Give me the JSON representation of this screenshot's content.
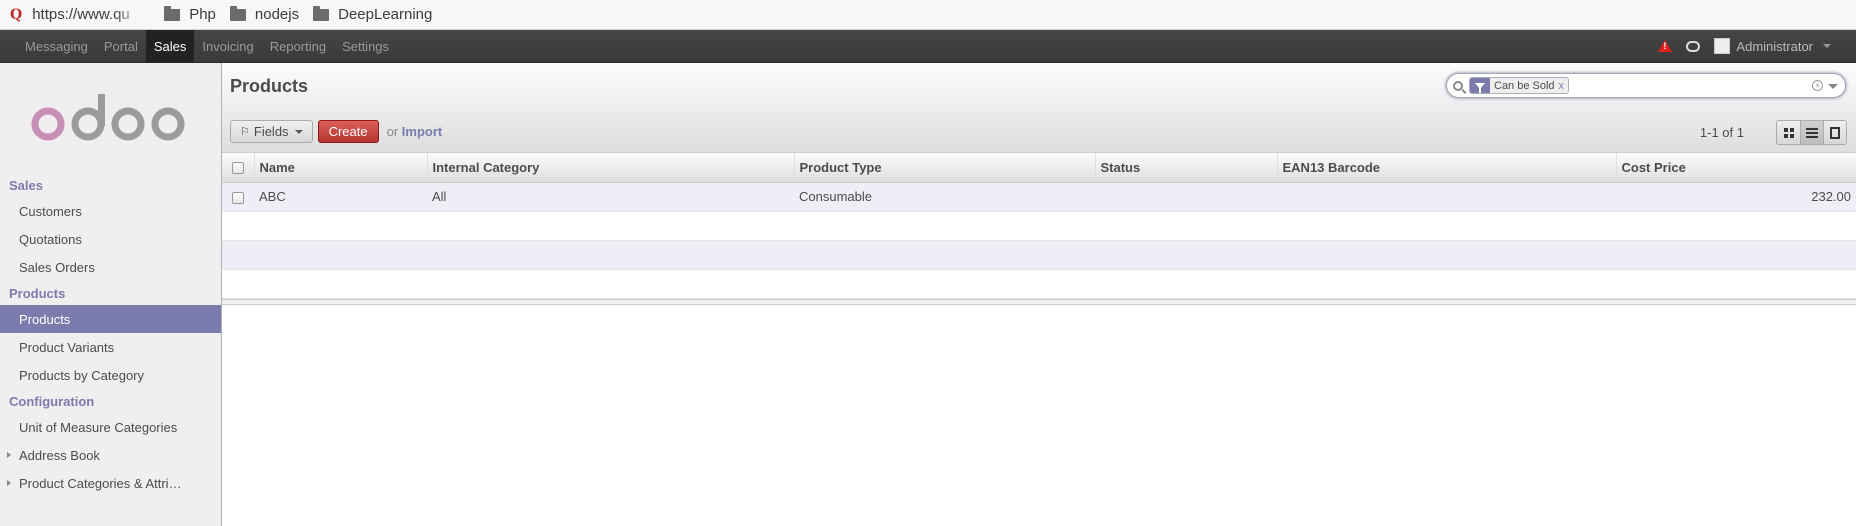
{
  "browser": {
    "url": "https://www.qu",
    "bookmarks": [
      "Php",
      "nodejs",
      "DeepLearning"
    ]
  },
  "topmenu": {
    "items": [
      {
        "label": "Messaging",
        "active": false
      },
      {
        "label": "Portal",
        "active": false
      },
      {
        "label": "Sales",
        "active": true
      },
      {
        "label": "Invoicing",
        "active": false
      },
      {
        "label": "Reporting",
        "active": false
      },
      {
        "label": "Settings",
        "active": false
      }
    ],
    "user": "Administrator"
  },
  "sidebar": {
    "sales_title": "Sales",
    "customers": "Customers",
    "quotations": "Quotations",
    "sales_orders": "Sales Orders",
    "products_title": "Products",
    "products": "Products",
    "product_variants": "Product Variants",
    "products_by_category": "Products by Category",
    "configuration_title": "Configuration",
    "uom_categories": "Unit of Measure Categories",
    "address_book": "Address Book",
    "product_categories": "Product Categories & Attri…"
  },
  "control_panel": {
    "title": "Products",
    "search_facet": "Can be Sold",
    "search_facet_remove": "x",
    "fields_label": "Fields",
    "create_label": "Create",
    "or_text": "or",
    "import_label": "Import",
    "pager": "1-1 of 1"
  },
  "table": {
    "columns": [
      "Name",
      "Internal Category",
      "Product Type",
      "Status",
      "EAN13 Barcode",
      "Cost Price"
    ],
    "rows": [
      {
        "name": "ABC",
        "category": "All",
        "type": "Consumable",
        "status": "",
        "barcode": "",
        "cost": "232.00"
      }
    ]
  },
  "colors": {
    "accent": "#7c7bad",
    "create_button": "#c0392b",
    "topbar": "#414141"
  }
}
